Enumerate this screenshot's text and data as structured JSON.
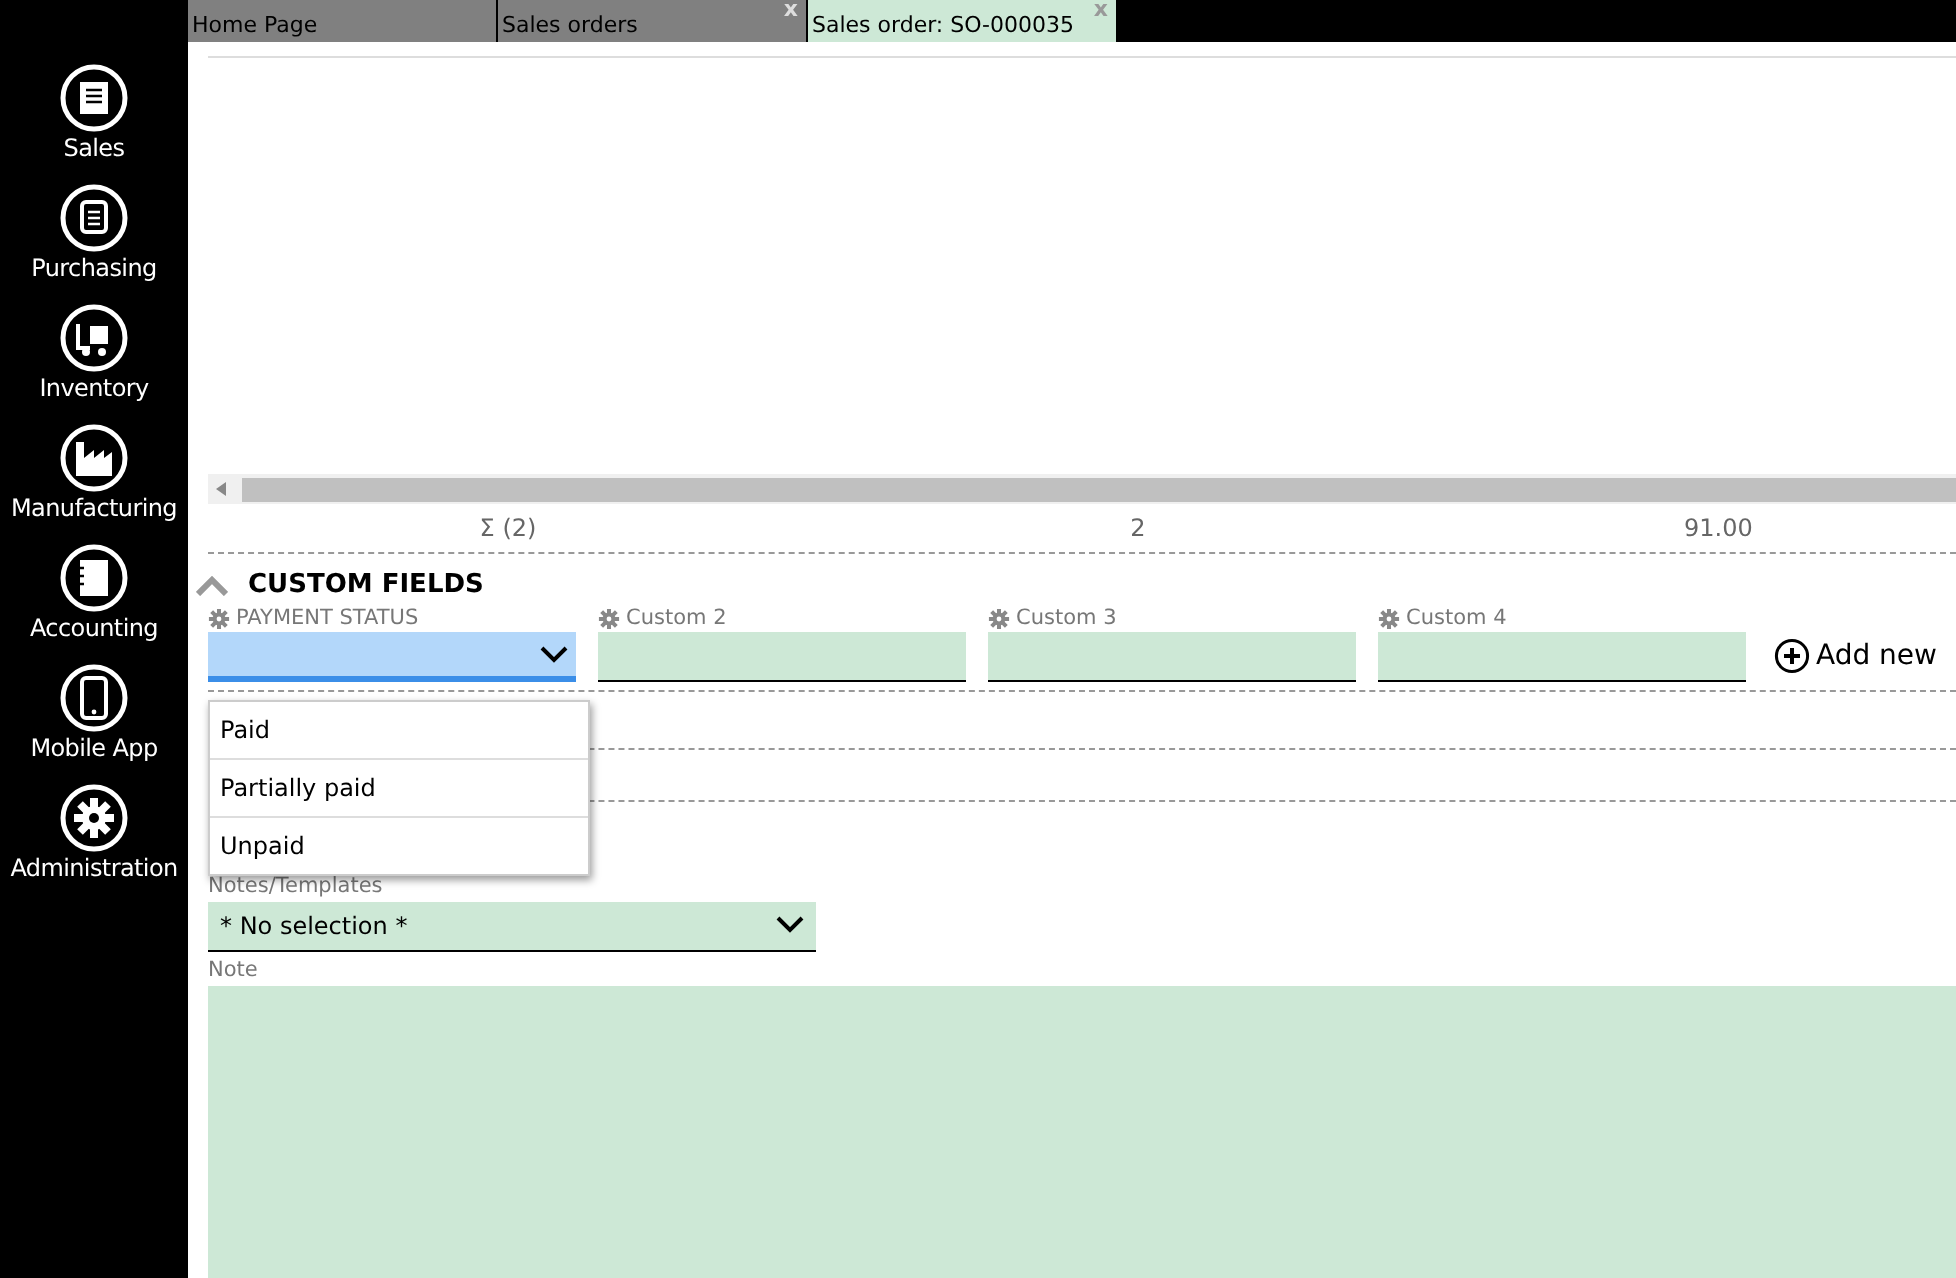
{
  "sidebar": {
    "items": [
      {
        "label": "Sales"
      },
      {
        "label": "Purchasing"
      },
      {
        "label": "Inventory"
      },
      {
        "label": "Manufacturing"
      },
      {
        "label": "Accounting"
      },
      {
        "label": "Mobile App"
      },
      {
        "label": "Administration"
      }
    ]
  },
  "tabs": [
    {
      "label": "Home Page",
      "selected": false
    },
    {
      "label": "Sales orders",
      "selected": false,
      "close": "x"
    },
    {
      "label": "Sales order: SO-000035",
      "selected": true,
      "close": "x"
    }
  ],
  "summary": {
    "cells": [
      "Σ (2)",
      "2",
      "91.00"
    ]
  },
  "custom_fields": {
    "title": "CUSTOM FIELDS",
    "expanded": true,
    "fields": [
      {
        "label": "PAYMENT STATUS",
        "kind": "dropdown",
        "focused": true
      },
      {
        "label": "Custom 2",
        "kind": "text",
        "focused": false
      },
      {
        "label": "Custom 3",
        "kind": "text",
        "focused": false
      },
      {
        "label": "Custom 4",
        "kind": "text",
        "focused": false
      }
    ],
    "add_new": "Add new"
  },
  "dropdown_menu": {
    "options": [
      "Paid",
      "Partially paid",
      "Unpaid"
    ]
  },
  "notes": {
    "templates_label": "Notes/Templates",
    "templates_value": "* No selection *",
    "note_label": "Note"
  }
}
